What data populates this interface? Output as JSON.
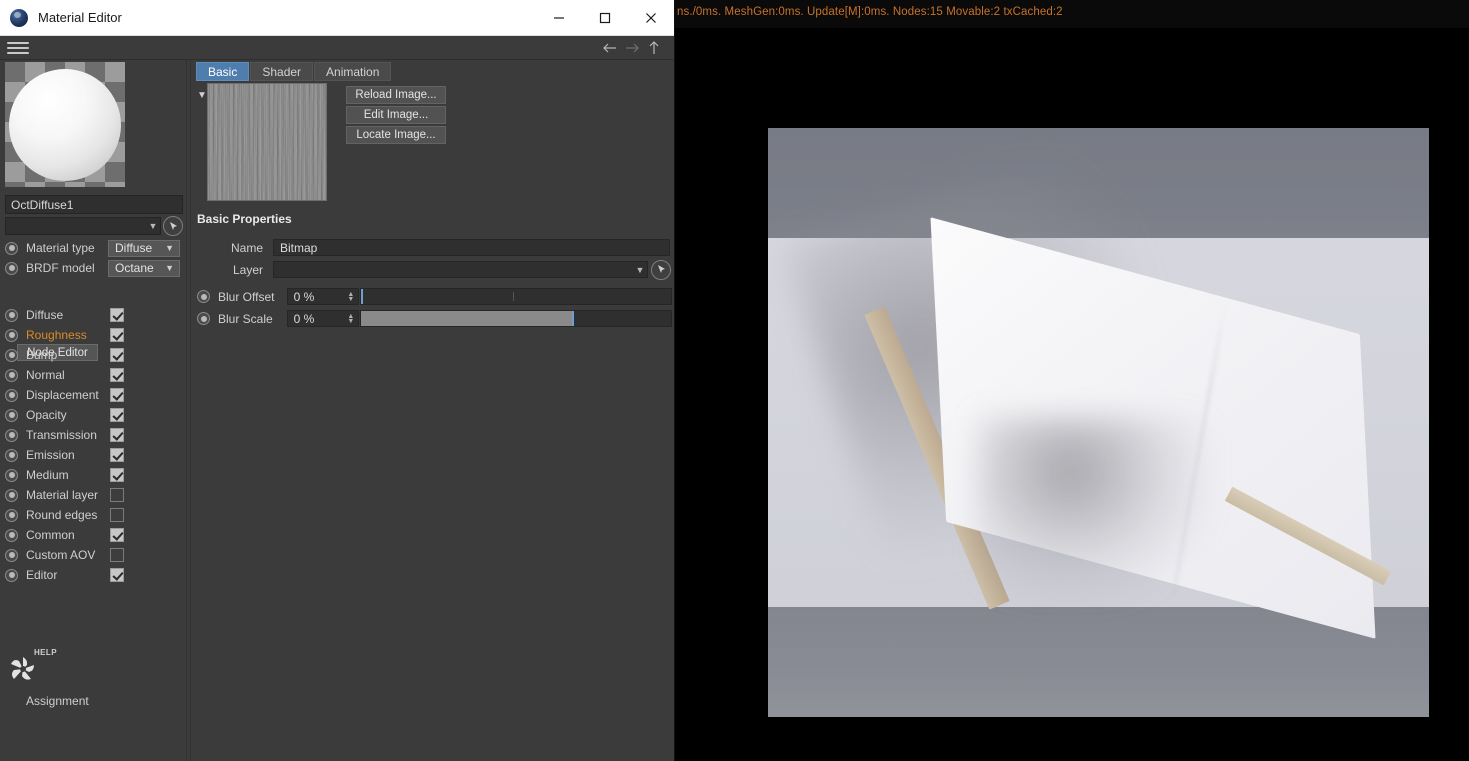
{
  "host": {
    "status_text": "ns./0ms. MeshGen:0ms. Update[M]:0ms. Nodes:15 Movable:2 txCached:2",
    "status_color": "#c8732a"
  },
  "window": {
    "title": "Material Editor",
    "logo_icon": "octane-logo-icon",
    "buttons": {
      "minimize": "minimize-icon",
      "maximize": "maximize-icon",
      "close": "close-icon"
    }
  },
  "toolbar": {
    "menu_icon": "hamburger-menu-icon",
    "back_icon": "arrow-left-icon",
    "forward_icon": "arrow-right-icon",
    "up_icon": "arrow-up-icon"
  },
  "sidebar": {
    "preview_alt": "material-sphere-preview",
    "material_name": "OctDiffuse1",
    "picker_icon": "eyedropper-picker-icon",
    "settings": [
      {
        "label": "Material type",
        "value": "Diffuse"
      },
      {
        "label": "BRDF model",
        "value": "Octane"
      }
    ],
    "node_editor_button": "Node Editor",
    "channels": [
      {
        "label": "Diffuse",
        "checked": true,
        "highlight": false
      },
      {
        "label": "Roughness",
        "checked": true,
        "highlight": true
      },
      {
        "label": "Bump",
        "checked": true,
        "highlight": false
      },
      {
        "label": "Normal",
        "checked": true,
        "highlight": false
      },
      {
        "label": "Displacement",
        "checked": true,
        "highlight": false
      },
      {
        "label": "Opacity",
        "checked": true,
        "highlight": false
      },
      {
        "label": "Transmission",
        "checked": true,
        "highlight": false
      },
      {
        "label": "Emission",
        "checked": true,
        "highlight": false
      },
      {
        "label": "Medium",
        "checked": true,
        "highlight": false
      },
      {
        "label": "Material layer",
        "checked": false,
        "highlight": false
      },
      {
        "label": "Round edges",
        "checked": false,
        "highlight": false
      },
      {
        "label": "Common",
        "checked": true,
        "highlight": false
      },
      {
        "label": "Custom AOV",
        "checked": false,
        "highlight": false
      },
      {
        "label": "Editor",
        "checked": true,
        "highlight": false
      }
    ],
    "help_label": "HELP",
    "help_icon": "octane-help-pinwheel-icon",
    "assignment_label": "Assignment"
  },
  "content": {
    "tabs": [
      {
        "label": "Basic",
        "active": true
      },
      {
        "label": "Shader",
        "active": false
      },
      {
        "label": "Animation",
        "active": false
      }
    ],
    "expander_icon": "chevron-down-icon",
    "texture_thumb_alt": "bitmap-texture-thumbnail",
    "image_buttons": [
      "Reload Image...",
      "Edit Image...",
      "Locate Image..."
    ],
    "section_title": "Basic Properties",
    "fields": {
      "name_label": "Name",
      "name_value": "Bitmap",
      "layer_label": "Layer",
      "layer_value": "",
      "layer_picker_icon": "eyedropper-picker-icon"
    },
    "sliders": [
      {
        "label": "Blur Offset",
        "value": "0 %",
        "fill_pct": 0,
        "handle_pct": 0,
        "tick_pct": 49
      },
      {
        "label": "Blur Scale",
        "value": "0 %",
        "fill_pct": 68,
        "handle_pct": 68,
        "tick_pct": -1
      }
    ]
  },
  "colors": {
    "panel_bg": "#3b3b3b",
    "accent_blue": "#4f7dad",
    "highlight_orange": "#d98a28",
    "status_orange": "#c8732a"
  }
}
